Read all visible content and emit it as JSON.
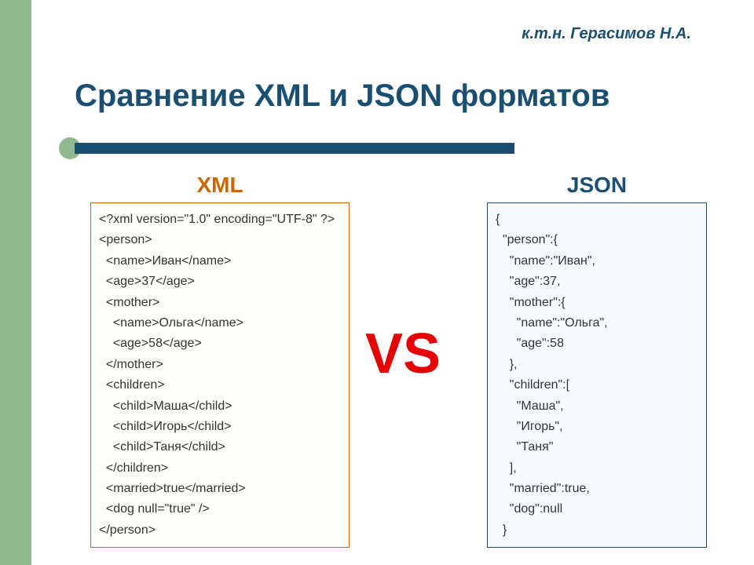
{
  "author": "к.т.н. Герасимов Н.А.",
  "title": "Сравнение XML и JSON форматов",
  "vs_label": "VS",
  "xml": {
    "heading": "XML",
    "lines": [
      "<?xml version=\"1.0\" encoding=\"UTF-8\" ?>",
      "<person>",
      "  <name>Иван</name>",
      "  <age>37</age>",
      "  <mother>",
      "    <name>Ольга</name>",
      "    <age>58</age>",
      "  </mother>",
      "  <children>",
      "    <child>Маша</child>",
      "    <child>Игорь</child>",
      "    <child>Таня</child>",
      "  </children>",
      "  <married>true</married>",
      "  <dog null=\"true\" />",
      "</person>"
    ]
  },
  "json": {
    "heading": "JSON",
    "lines": [
      "{",
      "  \"person\":{",
      "    \"name\":\"Иван\",",
      "    \"age\":37,",
      "    \"mother\":{",
      "      \"name\":\"Ольга\",",
      "      \"age\":58",
      "    },",
      "    \"children\":[",
      "      \"Маша\",",
      "      \"Игорь\",",
      "      \"Таня\"",
      "    ],",
      "    \"married\":true,",
      "    \"dog\":null",
      "  }"
    ]
  }
}
